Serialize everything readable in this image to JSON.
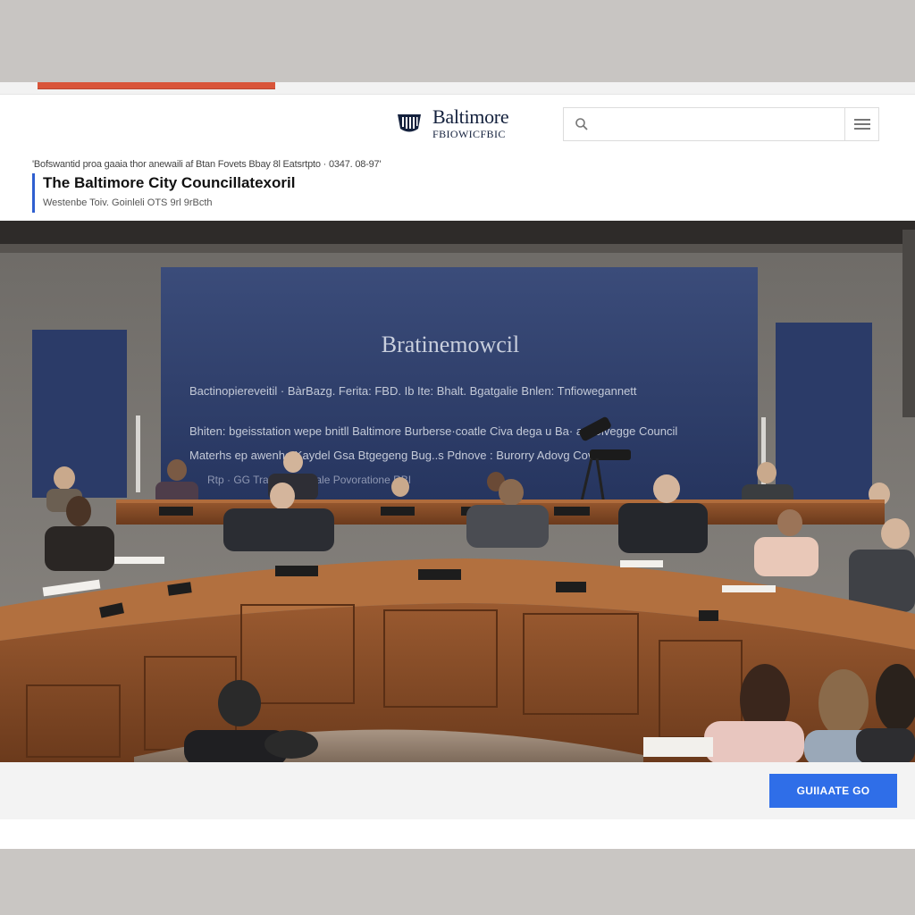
{
  "site": {
    "logo_title": "Baltimore",
    "logo_subtitle": "FBIOWICFBIC"
  },
  "search": {
    "placeholder": ""
  },
  "article": {
    "breadcrumb": "'Bofswantid proa gaaia thor anewaili af Btan Fovets Bbay 8l Eatsrtpto · 0347. 08-97'",
    "title": "The Baltimore City Councillatexoril",
    "meta": "Westenbe Toiv. Goinleli OTS 9rl 9rBcth"
  },
  "hero": {
    "backdrop_title": "Bratinemowcil",
    "backdrop_line1": "Bactinopiereveitil  ·  BàrBazg. Ferita:  FBD.  Ib  Ite: Bhalt. Bgatgalie  Bnlen: Tnfiowegannett",
    "backdrop_line2": "Bhiten: bgeisstation wepe bnitll  Baltimore Burberse·coatle Civa dega u  Ba·  ar: Clvegge Council",
    "backdrop_line3": "Materhs ep awenhe  Kaydel Gsa Btgegeng Bug..s Pdnove : Burorry        Adovg   Covesse",
    "backdrop_line4": "Rtp  · GG                 Trancs  Bbastale Povoratione              RBI",
    "colors": {
      "backdrop": "#2c3d6b",
      "desk_wood": "#8a4a26"
    }
  },
  "cta": {
    "label": "GUIIAATE GO",
    "color": "#2f6ee8"
  },
  "accent": "#2f5fd0",
  "brand_orange": "#d9553a"
}
